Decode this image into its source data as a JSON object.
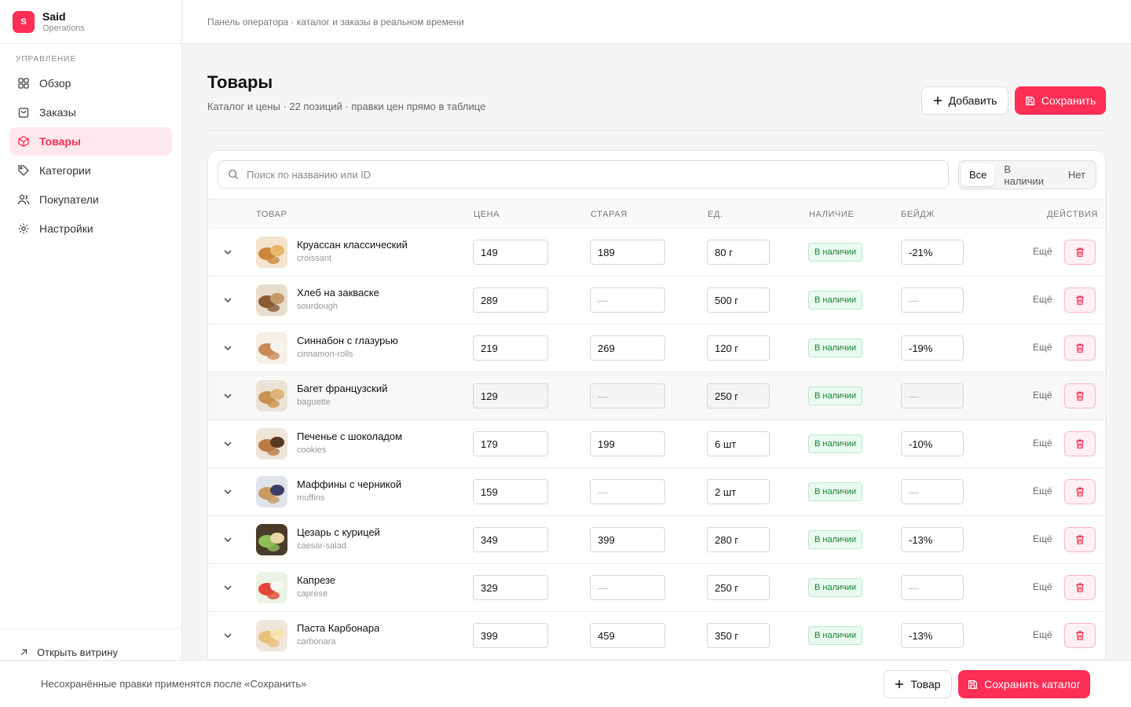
{
  "brand": {
    "initial": "S",
    "name": "Said",
    "sub": "Operations"
  },
  "nav": {
    "section": "Управление",
    "items": [
      {
        "label": "Обзор",
        "icon": "grid-icon"
      },
      {
        "label": "Заказы",
        "icon": "bag-icon"
      },
      {
        "label": "Товары",
        "icon": "box-icon",
        "active": true
      },
      {
        "label": "Категории",
        "icon": "tag-icon"
      },
      {
        "label": "Покупатели",
        "icon": "users-icon"
      },
      {
        "label": "Настройки",
        "icon": "gear-icon"
      }
    ],
    "open_shop": "Открыть витрину"
  },
  "topbar": {
    "text": "Панель оператора · каталог и заказы в реальном времени"
  },
  "page": {
    "title": "Товары",
    "subtitle": "Каталог и цены · 22 позиций · правки цен прямо в таблице",
    "add_label": "Добавить",
    "save_label": "Сохранить"
  },
  "search": {
    "placeholder": "Поиск по названию или ID"
  },
  "filter": {
    "options": [
      "Все",
      "В наличии",
      "Нет"
    ],
    "selected": "Все"
  },
  "table": {
    "headers": {
      "product": "Товар",
      "price": "Цена",
      "old": "Старая",
      "unit": "Ед.",
      "stock": "Наличие",
      "badge": "Бейдж",
      "actions": "Действия"
    },
    "more_label": "Ещё",
    "rows": [
      {
        "name": "Круассан классический",
        "slug": "croissant",
        "price": "149",
        "old": "189",
        "unit": "80 г",
        "stock": "В наличии",
        "badge": "-21%",
        "thumb": [
          "#f3e3cf",
          "#c9873d",
          "#e9b56b"
        ]
      },
      {
        "name": "Хлеб на закваске",
        "slug": "sourdough",
        "price": "289",
        "old": "—",
        "unit": "500 г",
        "stock": "В наличии",
        "badge": "—",
        "thumb": [
          "#e8dccd",
          "#8a5a33",
          "#c79a6a"
        ]
      },
      {
        "name": "Синнабон с глазурью",
        "slug": "cinnamon-rolls",
        "price": "219",
        "old": "269",
        "unit": "120 г",
        "stock": "В наличии",
        "badge": "-19%",
        "thumb": [
          "#f5efe6",
          "#c98a55",
          "#f8f4ee"
        ]
      },
      {
        "name": "Багет французский",
        "slug": "baguette",
        "price": "129",
        "old": "—",
        "unit": "250 г",
        "stock": "В наличии",
        "badge": "—",
        "thumb": [
          "#ede3d5",
          "#c7924f",
          "#dfb47a"
        ]
      },
      {
        "name": "Печенье с шоколадом",
        "slug": "cookies",
        "price": "179",
        "old": "199",
        "unit": "6 шт",
        "stock": "В наличии",
        "badge": "-10%",
        "thumb": [
          "#efe5d8",
          "#b97a45",
          "#5a3820"
        ]
      },
      {
        "name": "Маффины с черникой",
        "slug": "muffins",
        "price": "159",
        "old": "—",
        "unit": "2 шт",
        "stock": "В наличии",
        "badge": "—",
        "thumb": [
          "#dfe3ea",
          "#c79a5e",
          "#3b3f66"
        ]
      },
      {
        "name": "Цезарь с курицей",
        "slug": "caesar-salad",
        "price": "349",
        "old": "399",
        "unit": "280 г",
        "stock": "В наличии",
        "badge": "-13%",
        "thumb": [
          "#4a3a2a",
          "#8fbf5a",
          "#e8d8a8"
        ]
      },
      {
        "name": "Капрезе",
        "slug": "caprese",
        "price": "329",
        "old": "—",
        "unit": "250 г",
        "stock": "В наличии",
        "badge": "—",
        "thumb": [
          "#eaf3e6",
          "#e0463a",
          "#f7f7f2"
        ]
      },
      {
        "name": "Паста Карбонара",
        "slug": "carbonara",
        "price": "399",
        "old": "459",
        "unit": "350 г",
        "stock": "В наличии",
        "badge": "-13%",
        "thumb": [
          "#efe7dc",
          "#e8c27a",
          "#f6e2b0"
        ]
      }
    ]
  },
  "footer": {
    "message": "Несохранённые правки применятся после «Сохранить»",
    "add_label": "Товар",
    "save_label": "Сохранить каталог"
  },
  "colors": {
    "accent": "#ff2e55",
    "stock_green": "#1a7f37"
  }
}
